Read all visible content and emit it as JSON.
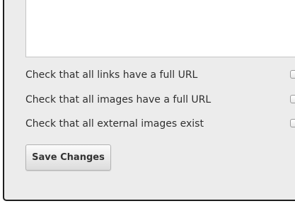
{
  "form": {
    "textarea_value": "",
    "options": [
      {
        "label": "Check that all links have a full URL",
        "checked": false
      },
      {
        "label": "Check that all images have a full URL",
        "checked": false
      },
      {
        "label": "Check that all external images exist",
        "checked": false
      }
    ],
    "save_label": "Save Changes"
  }
}
